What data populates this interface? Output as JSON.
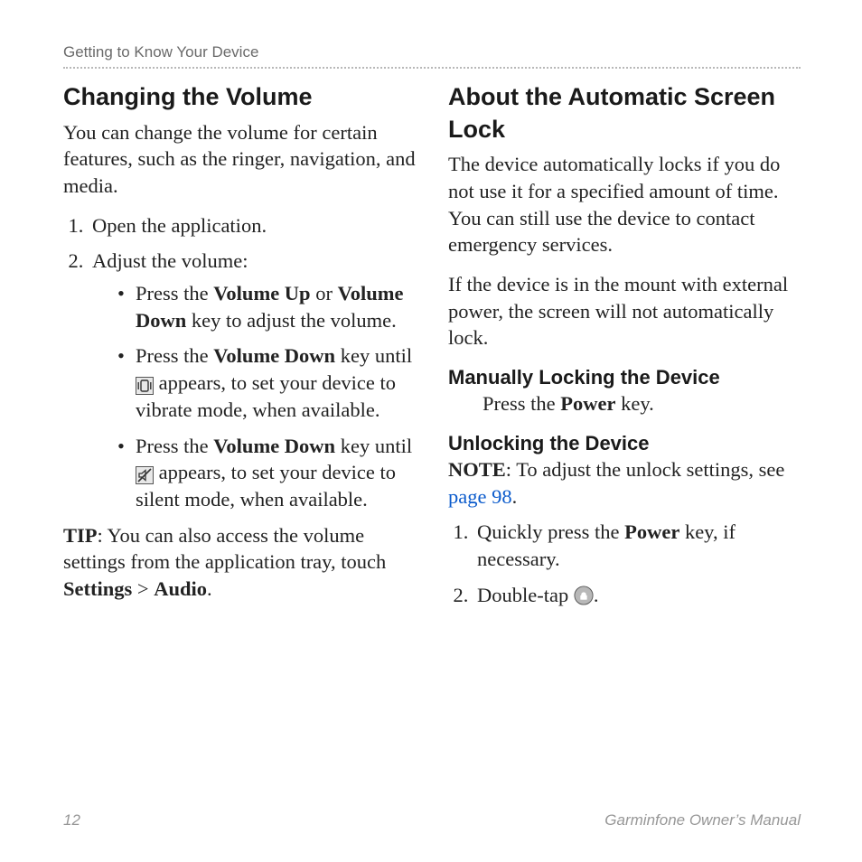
{
  "header": "Getting to Know Your Device",
  "left": {
    "h2": "Changing the Volume",
    "intro": "You can change the volume for certain features, such as the ringer, navigation, and media.",
    "step1": "Open the application.",
    "step2": "Adjust the volume:",
    "b1_pre": "Press the ",
    "b1_bold1": "Volume Up",
    "b1_mid": " or ",
    "b1_bold2": "Volume Down",
    "b1_post": " key to adjust the volume.",
    "b2_pre": "Press the ",
    "b2_bold": "Volume Down",
    "b2_mid": " key until ",
    "b2_post": " appears, to set your device to vibrate mode, when available.",
    "b3_pre": "Press the ",
    "b3_bold": "Volume Down",
    "b3_mid": " key until ",
    "b3_post": " appears, to set your device to silent mode, when available.",
    "tip_label": "TIP",
    "tip_body1": ": You can also access the volume settings from the application tray, touch ",
    "tip_settings": "Settings",
    "tip_gt": " > ",
    "tip_audio": "Audio",
    "tip_end": "."
  },
  "right": {
    "h2": "About the Automatic Screen Lock",
    "p1": "The device automatically locks if you do not use it for a specified amount of time. You can still use the device to contact emergency services.",
    "p2": "If the device is in the mount with external power, the screen will not automatically lock.",
    "h3a": "Manually Locking the Device",
    "h3a_body_pre": "Press the ",
    "h3a_body_bold": "Power",
    "h3a_body_post": " key.",
    "h3b": "Unlocking the Device",
    "note_label": "NOTE",
    "note_body1": ": To adjust the unlock settings, see ",
    "note_link": "page 98",
    "note_end": ".",
    "u_step1_pre": "Quickly press the ",
    "u_step1_bold": "Power",
    "u_step1_post": " key, if necessary.",
    "u_step2_pre": "Double-tap ",
    "u_step2_post": "."
  },
  "footer": {
    "page": "12",
    "title": "Garminfone Owner’s Manual"
  }
}
